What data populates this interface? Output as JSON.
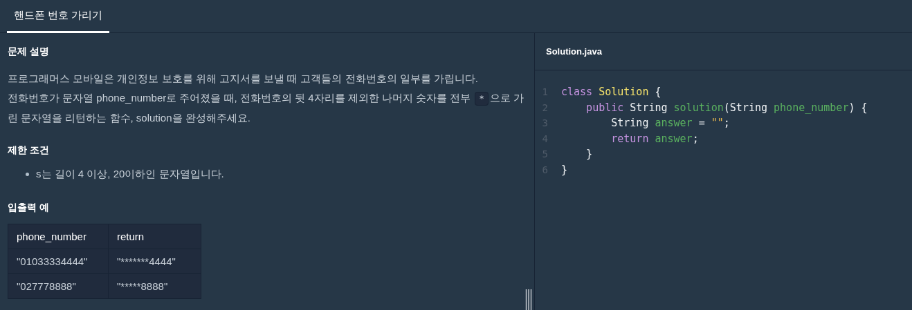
{
  "tabs": [
    {
      "label": "핸드폰 번호 가리기",
      "selected": true
    }
  ],
  "problem": {
    "heading": "문제 설명",
    "paragraphs": [
      [
        {
          "kind": "text",
          "text": "프로그래머스 모바일은 개인정보 보호를 위해 고지서를 보낼 때 고객들의 전화번호의 일부를 가립니다."
        }
      ],
      [
        {
          "kind": "text",
          "text": "전화번호가 문자열 phone_number로 주어졌을 때, 전화번호의 뒷 4자리를 제외한 나머지 숫자를 전부 "
        },
        {
          "kind": "code",
          "text": "*"
        },
        {
          "kind": "text",
          "text": "으로 가린 문자열을 리턴하는 함수, solution을 완성해주세요."
        }
      ]
    ],
    "constraints_heading": "제한 조건",
    "constraints": [
      "s는 길이 4 이상, 20이하인 문자열입니다."
    ],
    "examples_heading": "입출력 예",
    "table": {
      "columns": [
        "phone_number",
        "return"
      ],
      "rows": [
        [
          "\"01033334444\"",
          "\"*******4444\""
        ],
        [
          "\"027778888\"",
          "\"*****8888\""
        ]
      ]
    }
  },
  "editor": {
    "filename": "Solution.java",
    "lines": [
      {
        "number": "1",
        "tokens": [
          {
            "kind": "keyword",
            "text": "class"
          },
          {
            "kind": "type",
            "text": " Solution"
          },
          {
            "kind": "plain",
            "text": " {"
          }
        ]
      },
      {
        "number": "2",
        "tokens": [
          {
            "kind": "keyword",
            "text": "    public"
          },
          {
            "kind": "plain",
            "text": " String "
          },
          {
            "kind": "name",
            "text": "solution"
          },
          {
            "kind": "plain",
            "text": "(String "
          },
          {
            "kind": "name",
            "text": "phone_number"
          },
          {
            "kind": "plain",
            "text": ") {"
          }
        ]
      },
      {
        "number": "3",
        "tokens": [
          {
            "kind": "plain",
            "text": "        String "
          },
          {
            "kind": "name",
            "text": "answer"
          },
          {
            "kind": "plain",
            "text": " = "
          },
          {
            "kind": "string",
            "text": "\"\""
          },
          {
            "kind": "plain",
            "text": ";"
          }
        ]
      },
      {
        "number": "4",
        "tokens": [
          {
            "kind": "keyword",
            "text": "        return"
          },
          {
            "kind": "name",
            "text": " answer"
          },
          {
            "kind": "plain",
            "text": ";"
          }
        ]
      },
      {
        "number": "5",
        "tokens": [
          {
            "kind": "plain",
            "text": "    }"
          }
        ]
      },
      {
        "number": "6",
        "tokens": [
          {
            "kind": "plain",
            "text": "}"
          }
        ]
      }
    ]
  }
}
